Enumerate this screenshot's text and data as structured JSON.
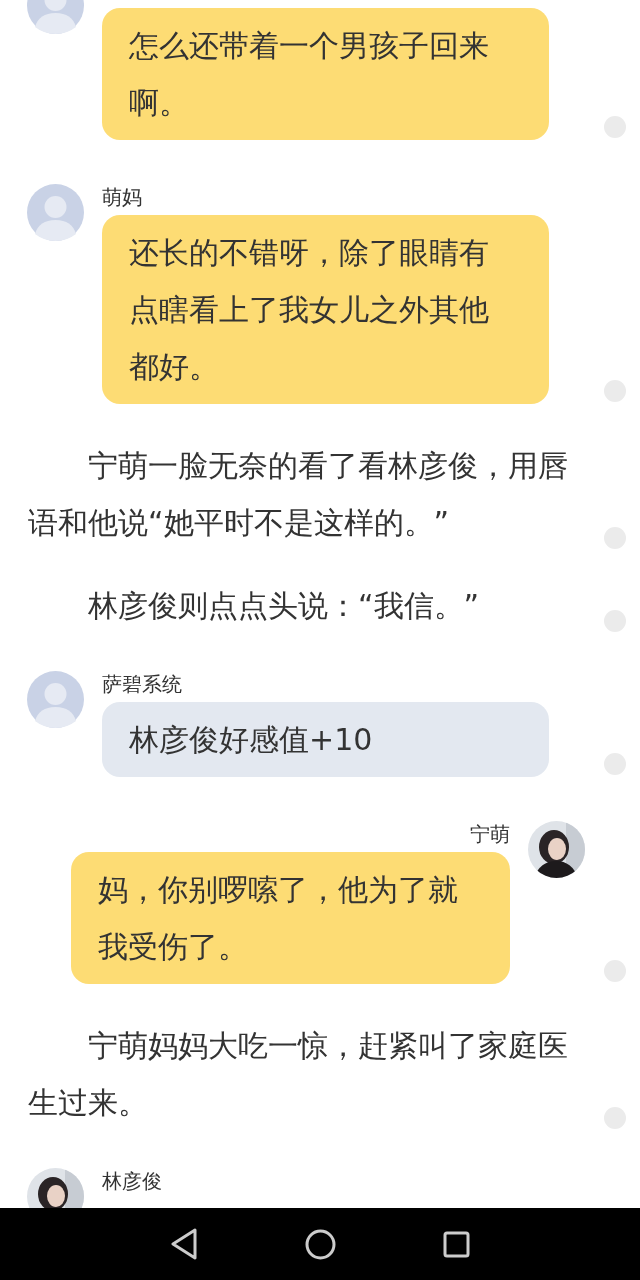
{
  "items": [
    {
      "kind": "incoming",
      "photo": false,
      "color": "#fddc74",
      "text": "怎么还带着一个男孩子回来啊。"
    },
    {
      "kind": "incoming",
      "photo": false,
      "sender": "萌妈",
      "color": "#fddc74",
      "text": "还长的不错呀，除了眼睛有点瞎看上了我女儿之外其他都好。"
    },
    {
      "kind": "narration",
      "text": "宁萌一脸无奈的看了看林彦俊，用唇语和他说“她平时不是这样的。”"
    },
    {
      "kind": "narration",
      "text": "林彦俊则点点头说：“我信。”"
    },
    {
      "kind": "incoming",
      "photo": false,
      "sender": "萨碧系统",
      "color": "#e3e8f0",
      "text": "林彦俊好感值+10"
    },
    {
      "kind": "outgoing",
      "photo": true,
      "sender": "宁萌",
      "color": "#fddc74",
      "text": "妈，你别啰嗦了，他为了就我受伤了。"
    },
    {
      "kind": "narration",
      "text": "宁萌妈妈大吃一惊，赶紧叫了家庭医生过来。"
    },
    {
      "kind": "incoming",
      "photo": true,
      "sender": "林彦俊"
    }
  ]
}
